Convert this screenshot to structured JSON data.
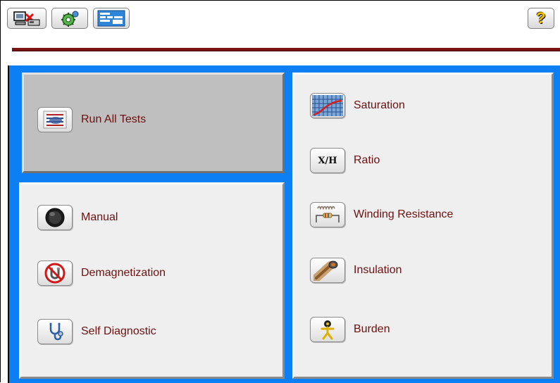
{
  "toolbar": {
    "buttons": [
      {
        "icon": "disconnect-computer-icon"
      },
      {
        "icon": "gear-settings-icon"
      },
      {
        "icon": "form-document-icon"
      }
    ],
    "help_label": "?"
  },
  "left_panel": {
    "run_all": {
      "label": "Run All Tests",
      "icon": "checklist-icon"
    },
    "items": [
      {
        "label": "Manual",
        "icon": "knob-icon"
      },
      {
        "label": "Demagnetization",
        "icon": "no-magnet-icon"
      },
      {
        "label": "Self Diagnostic",
        "icon": "stethoscope-icon"
      }
    ]
  },
  "right_panel": {
    "items": [
      {
        "label": "Saturation",
        "icon": "saturation-curve-icon"
      },
      {
        "label": "Ratio",
        "icon": "ratio-xh-icon",
        "icon_text": "X/H"
      },
      {
        "label": "Winding Resistance",
        "icon": "coil-resistor-icon"
      },
      {
        "label": "Insulation",
        "icon": "cable-insulation-icon"
      },
      {
        "label": "Burden",
        "icon": "burden-figure-icon"
      }
    ]
  },
  "colors": {
    "accent_blue": "#0d7ff5",
    "label_dark_red": "#6d1010",
    "separator_red": "#7c1414"
  }
}
